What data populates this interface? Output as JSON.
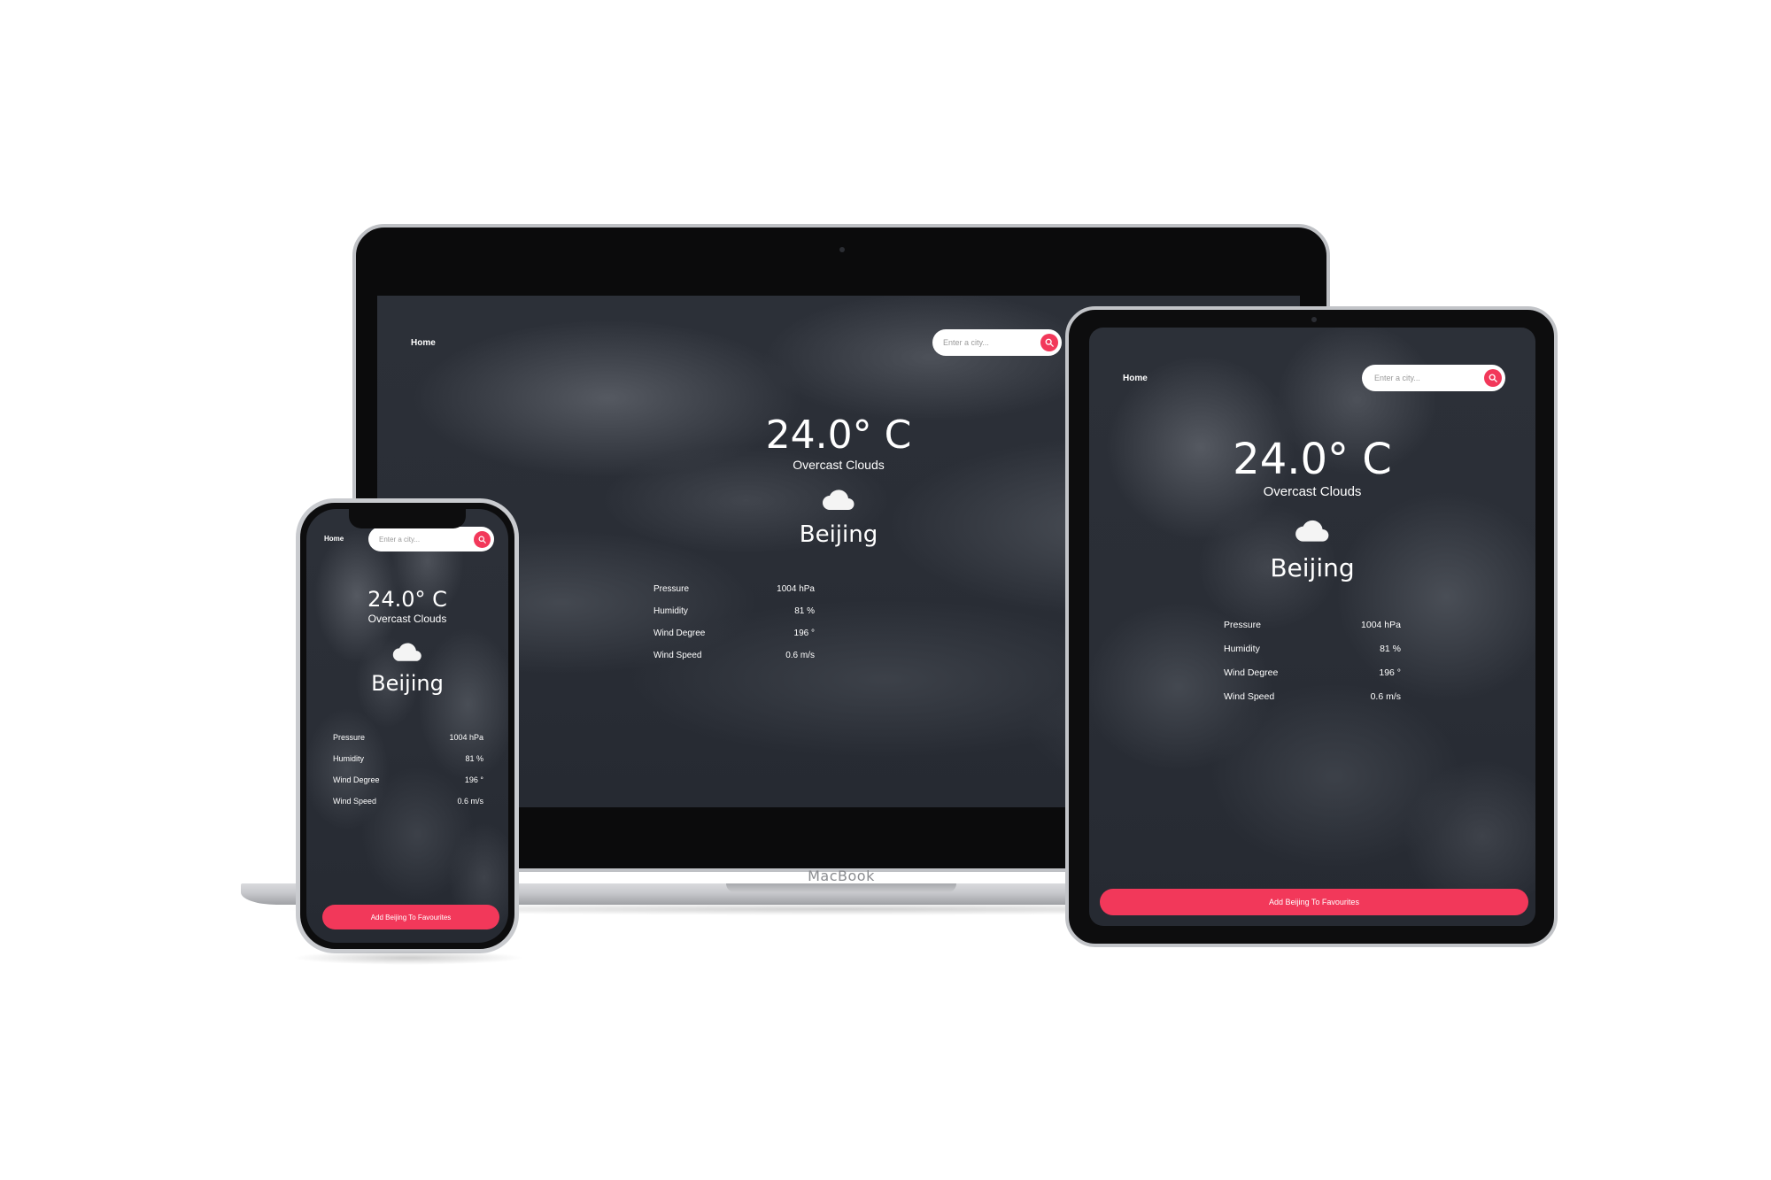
{
  "nav": {
    "home_label": "Home"
  },
  "search": {
    "placeholder": "Enter a city..."
  },
  "weather": {
    "temperature": "24.0° C",
    "description": "Overcast Clouds",
    "city": "Beijing",
    "icon": "cloud-icon"
  },
  "stats": [
    {
      "label": "Pressure",
      "value": "1004 hPa"
    },
    {
      "label": "Humidity",
      "value": "81 %"
    },
    {
      "label": "Wind Degree",
      "value": "196 °"
    },
    {
      "label": "Wind Speed",
      "value": "0.6 m/s"
    }
  ],
  "favourite_button": {
    "label": "Add Beijing To Favourites"
  },
  "device_labels": {
    "laptop_brand": "MacBook"
  },
  "colors": {
    "accent": "#f2385a",
    "background_dark": "#2a2e36"
  }
}
